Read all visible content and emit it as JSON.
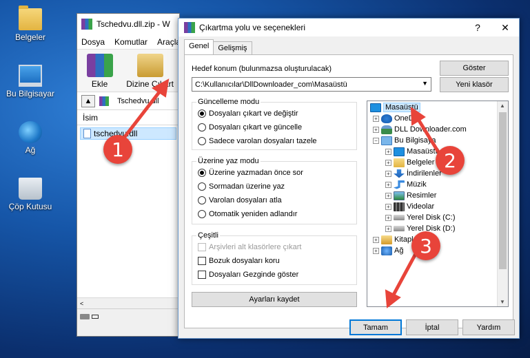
{
  "desktop": {
    "icons": [
      {
        "label": "Belgeler",
        "icon": "folder-icon"
      },
      {
        "label": "Bu Bilgisayar",
        "icon": "computer-icon"
      },
      {
        "label": "Ağ",
        "icon": "network-icon"
      },
      {
        "label": "Çöp Kutusu",
        "icon": "recycle-bin-icon"
      }
    ]
  },
  "winrar": {
    "title": "Tschedvu.dll.zip - W",
    "menu": [
      "Dosya",
      "Komutlar",
      "Araçla"
    ],
    "toolbar": {
      "add_label": "Ekle",
      "extract_label": "Dizine Çıkart"
    },
    "path": "Tschedvu.dll",
    "column_name": "İsim",
    "file": "tschedvu.dll"
  },
  "dialog": {
    "title": "Çıkartma yolu ve seçenekleri",
    "help_symbol": "?",
    "close_symbol": "✕",
    "tabs": [
      {
        "label": "Genel"
      },
      {
        "label": "Gelişmiş"
      }
    ],
    "destination": {
      "label": "Hedef konum (bulunmazsa oluşturulacak)",
      "value": "C:\\Kullanıcılar\\DllDownloader_com\\Masaüstü"
    },
    "buttons": {
      "show": "Göster",
      "new_folder": "Yeni klasör",
      "save_settings": "Ayarları kaydet",
      "ok": "Tamam",
      "cancel": "İptal",
      "help": "Yardım"
    },
    "update_mode": {
      "title": "Güncelleme modu",
      "options": [
        "Dosyaları çıkart ve değiştir",
        "Dosyaları çıkart ve güncelle",
        "Sadece varolan dosyaları tazele"
      ],
      "selected": 0
    },
    "overwrite_mode": {
      "title": "Üzerine yaz modu",
      "options": [
        "Üzerine yazmadan önce sor",
        "Sormadan üzerine yaz",
        "Varolan dosyaları atla",
        "Otomatik yeniden adlandır"
      ],
      "selected": 0
    },
    "misc": {
      "title": "Çeşitli",
      "options": [
        {
          "label": "Arşivleri alt klasörlere çıkart",
          "checked": false,
          "disabled": true
        },
        {
          "label": "Bozuk dosyaları koru",
          "checked": false,
          "disabled": false
        },
        {
          "label": "Dosyaları Gezginde göster",
          "checked": false,
          "disabled": false
        }
      ]
    },
    "tree": [
      {
        "label": "Masaüstü",
        "icon": "desktop-icon",
        "level": 0,
        "expander": "",
        "selected": true
      },
      {
        "label": "OneD",
        "icon": "onedrive-icon",
        "level": 1,
        "expander": "+"
      },
      {
        "label": "DLL Downloader.com",
        "icon": "user-icon",
        "level": 1,
        "expander": "+"
      },
      {
        "label": "Bu Bilgisaya",
        "icon": "computer-icon",
        "level": 1,
        "expander": "−"
      },
      {
        "label": "Masaüstü",
        "icon": "desktop-icon",
        "level": 2,
        "expander": "+"
      },
      {
        "label": "Belgeler",
        "icon": "folder-icon",
        "level": 2,
        "expander": "+"
      },
      {
        "label": "İndirilenler",
        "icon": "download-icon",
        "level": 2,
        "expander": "+"
      },
      {
        "label": "Müzik",
        "icon": "music-icon",
        "level": 2,
        "expander": "+"
      },
      {
        "label": "Resimler",
        "icon": "pictures-icon",
        "level": 2,
        "expander": "+"
      },
      {
        "label": "Videolar",
        "icon": "video-icon",
        "level": 2,
        "expander": "+"
      },
      {
        "label": "Yerel Disk (C:)",
        "icon": "disk-icon",
        "level": 2,
        "expander": "+"
      },
      {
        "label": "Yerel Disk (D:)",
        "icon": "disk-icon",
        "level": 2,
        "expander": "+"
      },
      {
        "label": "Kitapl",
        "icon": "library-icon",
        "level": 1,
        "expander": "+"
      },
      {
        "label": "Ağ",
        "icon": "network-icon",
        "level": 1,
        "expander": "+"
      }
    ]
  },
  "callouts": [
    "1",
    "2",
    "3"
  ],
  "colors": {
    "callout": "#e8443a",
    "selection": "#cce8ff",
    "accent": "#0078d7"
  }
}
